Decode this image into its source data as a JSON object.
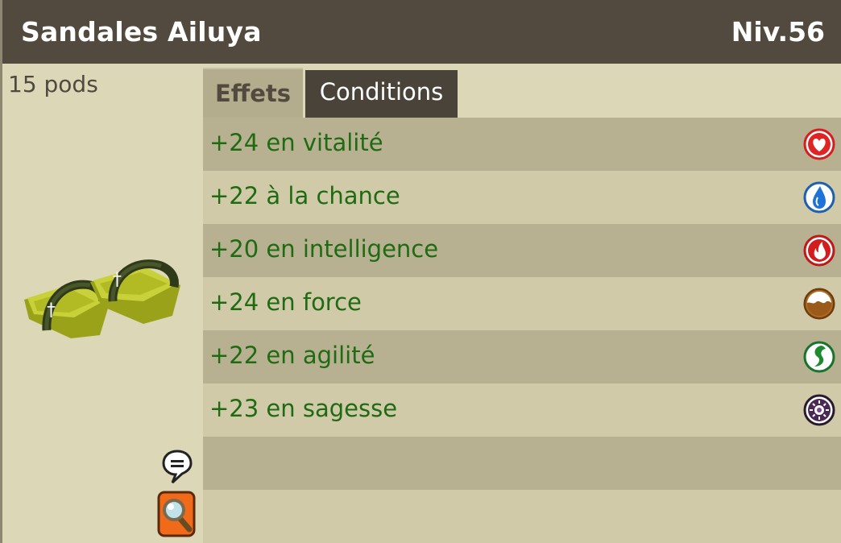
{
  "item": {
    "name": "Sandales Ailuya",
    "level": "Niv.56",
    "weight": "15 pods"
  },
  "tabs": [
    {
      "label": "Effets",
      "active": true
    },
    {
      "label": "Conditions",
      "active": false
    }
  ],
  "effects": [
    {
      "text": "+24 en vitalité",
      "icon": "vitality-heart-icon",
      "color": "#e02424"
    },
    {
      "text": "+22 à la chance",
      "icon": "chance-water-icon",
      "color": "#1e73d8"
    },
    {
      "text": "+20 en intelligence",
      "icon": "intelligence-fire-icon",
      "color": "#d41c1c"
    },
    {
      "text": "+24 en force",
      "icon": "strength-earth-icon",
      "color": "#9a5a1a"
    },
    {
      "text": "+22 en agilité",
      "icon": "agility-air-icon",
      "color": "#1d8a2d"
    },
    {
      "text": "+23 en sagesse",
      "icon": "wisdom-icon",
      "color": "#4a2a55"
    }
  ],
  "colors": {
    "titlebar": "#524a3e",
    "effect_text": "#1f6b12",
    "panel": "#dcd7b6"
  }
}
